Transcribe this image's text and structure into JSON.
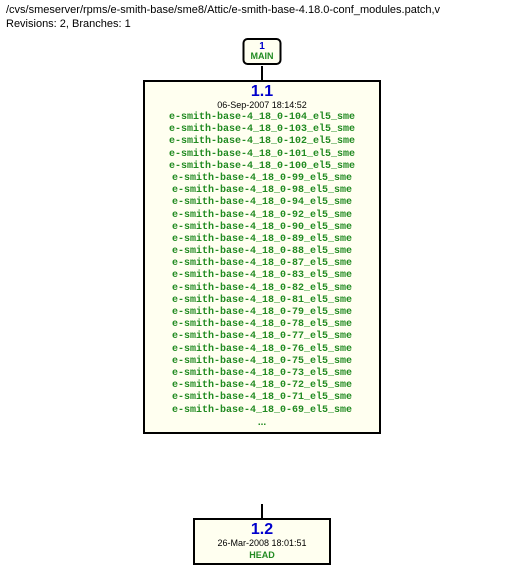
{
  "header": {
    "path": "/cvs/smeserver/rpms/e-smith-base/sme8/Attic/e-smith-base-4.18.0-conf_modules.patch,v",
    "revisions_line": "Revisions: 2, Branches: 1"
  },
  "branch": {
    "number": "1",
    "name": "MAIN"
  },
  "rev1": {
    "number": "1.1",
    "date": "06-Sep-2007 18:14:52",
    "tags": [
      "e-smith-base-4_18_0-104_el5_sme",
      "e-smith-base-4_18_0-103_el5_sme",
      "e-smith-base-4_18_0-102_el5_sme",
      "e-smith-base-4_18_0-101_el5_sme",
      "e-smith-base-4_18_0-100_el5_sme",
      "e-smith-base-4_18_0-99_el5_sme",
      "e-smith-base-4_18_0-98_el5_sme",
      "e-smith-base-4_18_0-94_el5_sme",
      "e-smith-base-4_18_0-92_el5_sme",
      "e-smith-base-4_18_0-90_el5_sme",
      "e-smith-base-4_18_0-89_el5_sme",
      "e-smith-base-4_18_0-88_el5_sme",
      "e-smith-base-4_18_0-87_el5_sme",
      "e-smith-base-4_18_0-83_el5_sme",
      "e-smith-base-4_18_0-82_el5_sme",
      "e-smith-base-4_18_0-81_el5_sme",
      "e-smith-base-4_18_0-79_el5_sme",
      "e-smith-base-4_18_0-78_el5_sme",
      "e-smith-base-4_18_0-77_el5_sme",
      "e-smith-base-4_18_0-76_el5_sme",
      "e-smith-base-4_18_0-75_el5_sme",
      "e-smith-base-4_18_0-73_el5_sme",
      "e-smith-base-4_18_0-72_el5_sme",
      "e-smith-base-4_18_0-71_el5_sme",
      "e-smith-base-4_18_0-69_el5_sme"
    ],
    "ellipsis": "..."
  },
  "rev2": {
    "number": "1.2",
    "date": "26-Mar-2008 18:01:51",
    "head": "HEAD"
  }
}
